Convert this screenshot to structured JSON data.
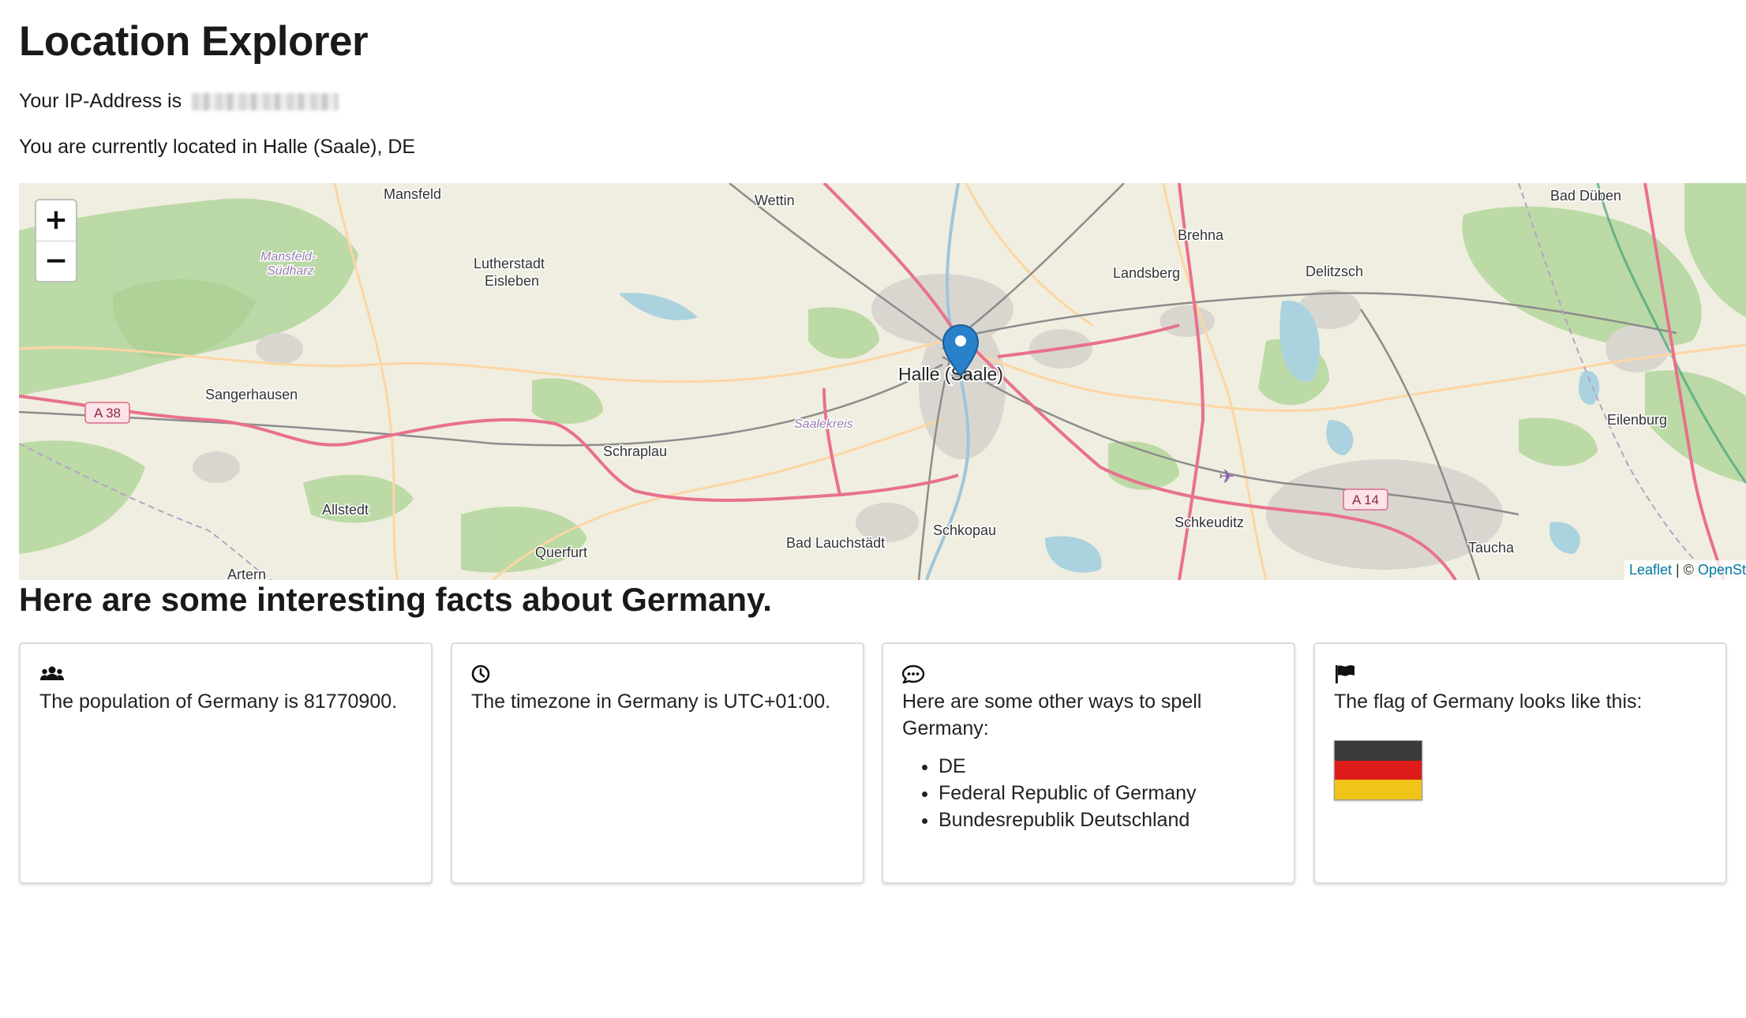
{
  "page": {
    "title": "Location Explorer",
    "ip_prefix": "Your IP-Address is",
    "location_text": "You are currently located in Halle (Saale), DE"
  },
  "map": {
    "zoom_in": "+",
    "zoom_out": "−",
    "attribution_leaflet": "Leaflet",
    "attribution_sep": " | © ",
    "attribution_osm": "OpenSt",
    "labels": {
      "mansfeld": "Mansfeld",
      "wettin": "Wettin",
      "bad_dueben": "Bad Düben",
      "brehna": "Brehna",
      "mansfeld_suedharz_1": "Mansfeld-",
      "mansfeld_suedharz_2": "Südharz",
      "lutherstadt": "Lutherstadt",
      "eisleben": "Eisleben",
      "landsberg": "Landsberg",
      "delitzsch": "Delitzsch",
      "halle": "Halle (Saale)",
      "sangerhausen": "Sangerhausen",
      "a38": "A 38",
      "saalekreis": "Saalekreis",
      "eilenburg": "Eilenburg",
      "schraplau": "Schraplau",
      "a14": "A 14",
      "allstedt": "Allstedt",
      "schkeuditz": "Schkeuditz",
      "schkopau": "Schkopau",
      "bad_lauchstaedt": "Bad Lauchstädt",
      "querfurt": "Querfurt",
      "taucha": "Taucha",
      "artern": "Artern"
    }
  },
  "facts": {
    "title": "Here are some interesting facts about Germany.",
    "population": "The population of Germany is 81770900.",
    "timezone": "The timezone in Germany is UTC+01:00.",
    "spellings_intro": "Here are some other ways to spell Germany:",
    "spellings": [
      "DE",
      "Federal Republic of Germany",
      "Bundesrepublik Deutschland"
    ],
    "flag_intro": "The flag of Germany looks like this:",
    "flag_colors": [
      "#3a3a3a",
      "#dd1c1a",
      "#f0c419"
    ]
  }
}
